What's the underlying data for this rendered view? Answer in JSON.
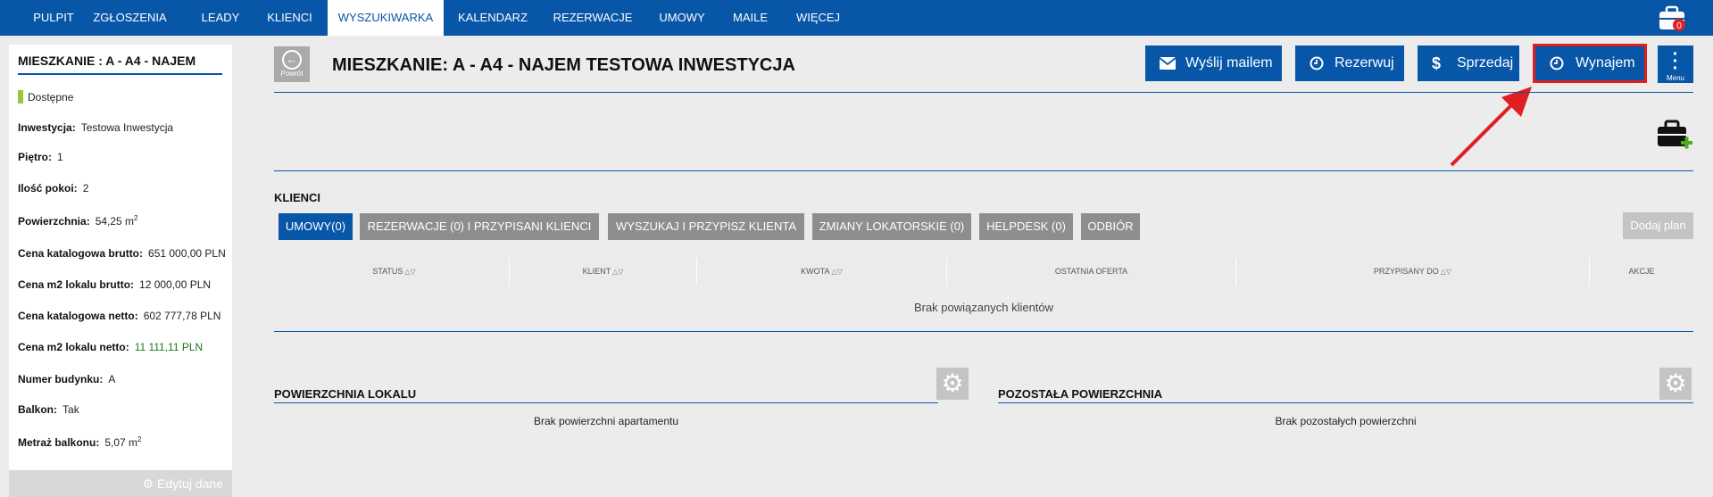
{
  "nav": {
    "items": [
      "PULPIT",
      "ZGŁOSZENIA",
      "LEADY",
      "KLIENCI",
      "WYSZUKIWARKA",
      "KALENDARZ",
      "REZERWACJE",
      "UMOWY",
      "MAILE",
      "WIĘCEJ"
    ],
    "active": "WYSZUKIWARKA",
    "bag_count": "0"
  },
  "sidebar": {
    "title": "MIESZKANIE : A - A4 - NAJEM",
    "status": "Dostępne",
    "rows": [
      {
        "label": "Inwestycja:",
        "value": "Testowa Inwestycja"
      },
      {
        "label": "Piętro:",
        "value": "1"
      },
      {
        "label": "Ilość pokoi:",
        "value": "2"
      },
      {
        "label": "Powierzchnia:",
        "value": "54,25 m",
        "sup": "2"
      },
      {
        "label": "Cena katalogowa brutto:",
        "value": "651 000,00 PLN"
      },
      {
        "label": "Cena m2 lokalu brutto:",
        "value": "12 000,00 PLN"
      },
      {
        "label": "Cena katalogowa netto:",
        "value": "602 777,78 PLN"
      },
      {
        "label": "Cena m2 lokalu netto:",
        "value": "11 111,11 PLN"
      },
      {
        "label": "Numer budynku:",
        "value": "A"
      },
      {
        "label": "Balkon:",
        "value": "Tak"
      },
      {
        "label": "Metraż balkonu:",
        "value": "5,07 m",
        "sup": "2"
      }
    ],
    "edit_label": "Edytuj dane"
  },
  "header": {
    "back_label": "Powrót",
    "title": "MIESZKANIE: A - A4 - NAJEM TESTOWA INWESTYCJA",
    "actions": {
      "email": "Wyślij mailem",
      "reserve": "Rezerwuj",
      "sell": "Sprzedaj",
      "rent": "Wynajem"
    },
    "menu_label": "Menu"
  },
  "clients": {
    "heading": "KLIENCI",
    "tabs": [
      "UMOWY(0)",
      "REZERWACJE (0) I PRZYPISANI KLIENCI",
      "WYSZUKAJ I PRZYPISZ KLIENTA",
      "ZMIANY LOKATORSKIE (0)",
      "HELPDESK (0)",
      "ODBIÓR"
    ],
    "add_plan": "Dodaj plan",
    "columns": [
      "STATUS",
      "KLIENT",
      "KWOTA",
      "OSTATNIA OFERTA",
      "PRZYPISANY DO",
      "AKCJE"
    ],
    "empty": "Brak powiązanych klientów"
  },
  "areas": {
    "left_heading": "POWIERZCHNIA LOKALU",
    "left_empty": "Brak powierzchni apartamentu",
    "right_heading": "POZOSTAŁA POWIERZCHNIA",
    "right_empty": "Brak pozostałych powierzchni"
  },
  "colors": {
    "brand": "#0856a8",
    "status_available": "#9bc53d",
    "highlight": "#e02020"
  }
}
